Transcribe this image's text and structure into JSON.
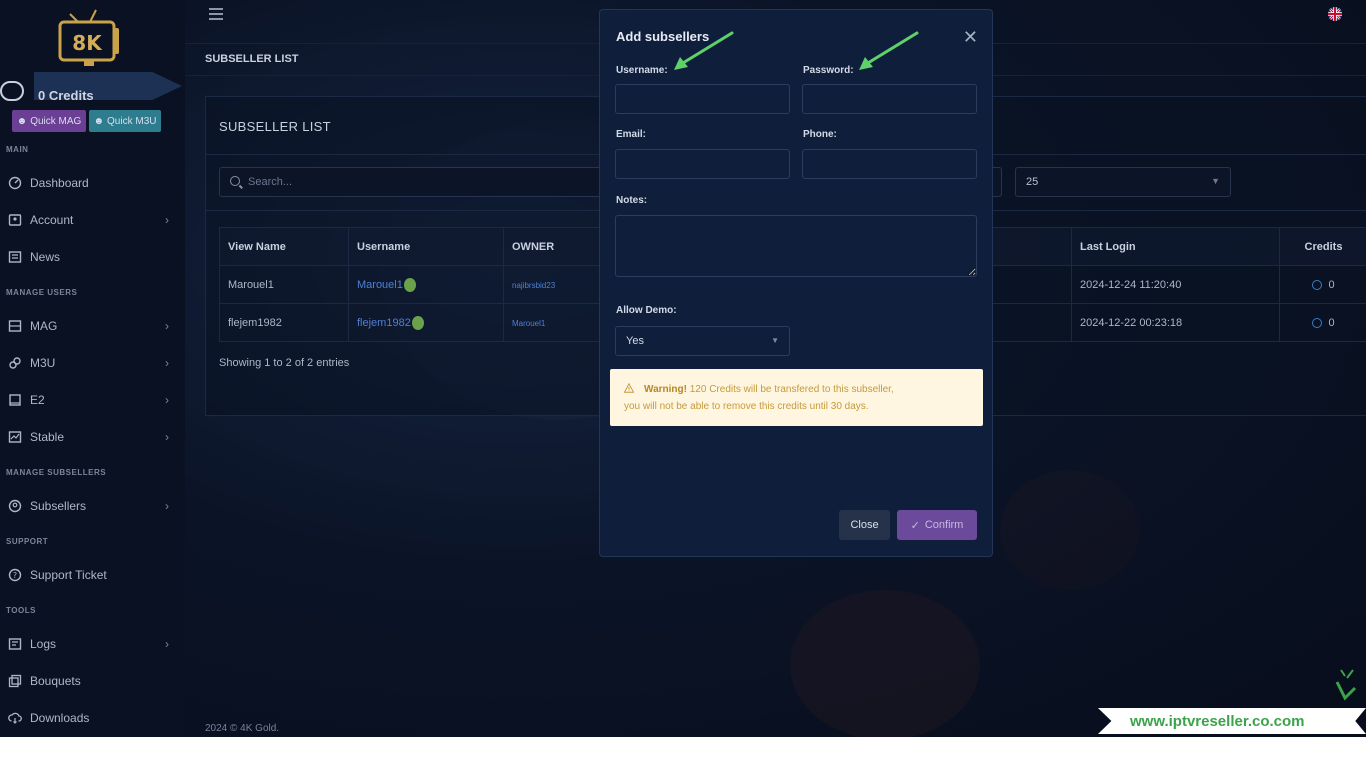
{
  "logo": {
    "text": "8K"
  },
  "sidebar": {
    "credits_text": "0 Credits",
    "quick_mag": "Quick MAG",
    "quick_m3u": "Quick M3U",
    "sections": {
      "main": "MAIN",
      "manage_users": "MANAGE USERS",
      "manage_subsellers": "MANAGE SUBSELLERS",
      "support": "SUPPORT",
      "tools": "TOOLS"
    },
    "items": [
      {
        "label": "Dashboard"
      },
      {
        "label": "Account"
      },
      {
        "label": "News"
      },
      {
        "label": "MAG"
      },
      {
        "label": "M3U"
      },
      {
        "label": "E2"
      },
      {
        "label": "Stable"
      },
      {
        "label": "Subsellers"
      },
      {
        "label": "Support Ticket"
      },
      {
        "label": "Logs"
      },
      {
        "label": "Bouquets"
      },
      {
        "label": "Downloads"
      }
    ]
  },
  "page": {
    "title": "SUBSELLER LIST"
  },
  "card": {
    "title": "SUBSELLER LIST",
    "search_placeholder": "Search...",
    "per_page": "25",
    "columns": [
      "View Name",
      "Username",
      "OWNER",
      "Last Login",
      "Credits"
    ],
    "rows": [
      {
        "view_name": "Marouel1",
        "username": "Marouel1",
        "owner": "najibrsbid23",
        "last_login": "2024-12-24 11:20:40",
        "credits": "0"
      },
      {
        "view_name": "flejem1982",
        "username": "flejem1982",
        "owner": "Marouel1",
        "last_login": "2024-12-22 00:23:18",
        "credits": "0"
      }
    ],
    "showing": "Showing 1 to 2 of 2 entries"
  },
  "footer": {
    "text": "2024 © 4K Gold."
  },
  "modal": {
    "title": "Add subsellers",
    "username_label": "Username:",
    "password_label": "Password:",
    "email_label": "Email:",
    "phone_label": "Phone:",
    "notes_label": "Notes:",
    "allow_demo_label": "Allow Demo:",
    "allow_demo_value": "Yes",
    "warning_strong": "Warning!",
    "warning_line1": "120 Credits will be transfered to this subseller,",
    "warning_line2": "you will not be able to remove this credits until 30 days.",
    "close_label": "Close",
    "confirm_label": "Confirm"
  },
  "watermark": {
    "text": "www.iptvreseller.co.com"
  },
  "colors": {
    "accent_green": "#5fd16a",
    "confirm_purple": "#6c4a9b",
    "link_blue": "#4f7fd6",
    "warning_bg": "#fff6e2"
  }
}
